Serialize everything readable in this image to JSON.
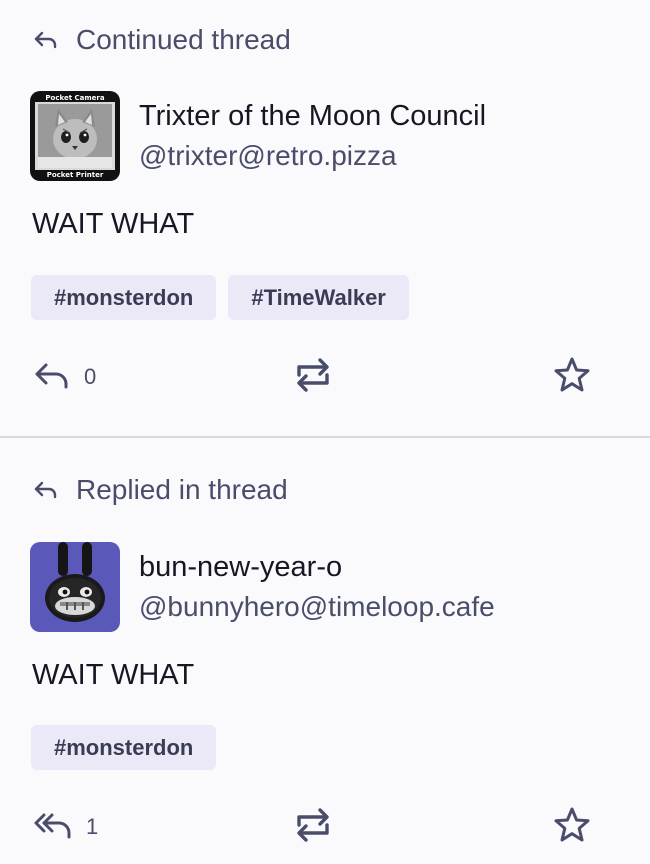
{
  "posts": [
    {
      "thread_note": "Continued thread",
      "thread_icon": "reply-arrow-icon",
      "display_name": "Trixter of the Moon Council",
      "handle": "@trixter@retro.pizza",
      "avatar": {
        "kind": "pocket-camera-cat",
        "top_text": "Pocket Camera",
        "bottom_text": "Pocket Printer"
      },
      "content": "WAIT WHAT",
      "tags": [
        "#monsterdon",
        "#TimeWalker"
      ],
      "reply_count": "0",
      "reply_icon": "reply-icon",
      "boost_icon": "boost-icon",
      "favourite_icon": "star-icon"
    },
    {
      "thread_note": "Replied in thread",
      "thread_icon": "reply-arrow-icon",
      "display_name": "bun-new-year-o",
      "handle": "@bunnyhero@timeloop.cafe",
      "avatar": {
        "kind": "bunny-robot"
      },
      "content": "WAIT WHAT",
      "tags": [
        "#monsterdon"
      ],
      "reply_count": "1",
      "reply_icon": "reply-all-icon",
      "boost_icon": "boost-icon",
      "favourite_icon": "star-icon"
    }
  ],
  "colors": {
    "background": "#fafafd",
    "text": "#171724",
    "secondary_text": "#4a4d6a",
    "tag_background": "#ebe9f8",
    "divider": "#d9d9e6",
    "avatar2_background": "#5a58b8"
  }
}
